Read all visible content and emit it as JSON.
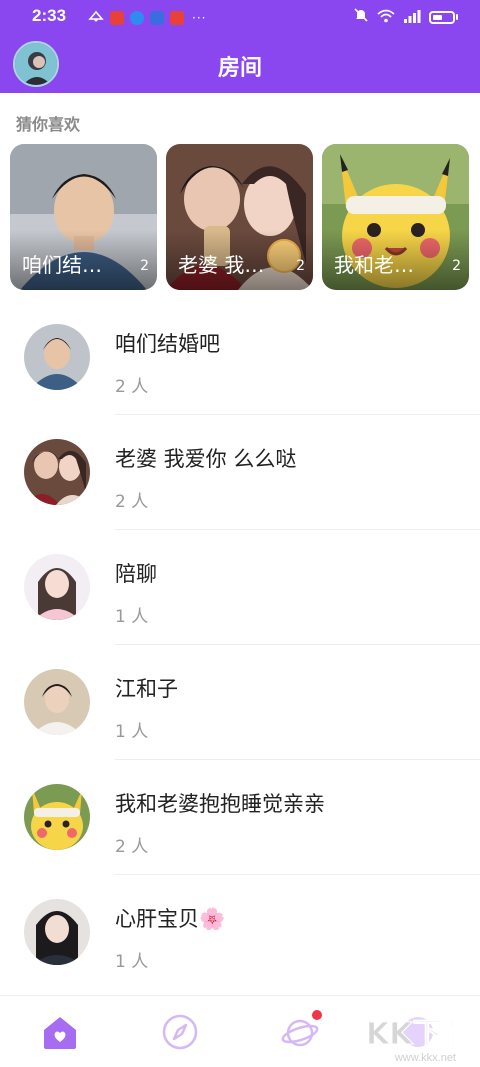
{
  "status_bar": {
    "time": "2:33",
    "more_dots": "···"
  },
  "header": {
    "title": "房间"
  },
  "recommend": {
    "label": "猜你喜欢",
    "cards": [
      {
        "title": "咱们结婚吧",
        "count": "2"
      },
      {
        "title": "老婆 我爱你 么么哒",
        "count": "2"
      },
      {
        "title": "我和老婆抱抱睡觉亲亲",
        "count": "2"
      }
    ]
  },
  "rooms": [
    {
      "name": "咱们结婚吧",
      "count": "2 人"
    },
    {
      "name": "老婆 我爱你 么么哒",
      "count": "2 人"
    },
    {
      "name": "陪聊",
      "count": "1 人"
    },
    {
      "name": "江和子",
      "count": "1 人"
    },
    {
      "name": "我和老婆抱抱睡觉亲亲",
      "count": "2 人"
    },
    {
      "name": "心肝宝贝🌸",
      "count": "1 人"
    }
  ],
  "bottom_nav": {
    "items": [
      "home-icon",
      "compass-icon",
      "planet-icon",
      "profile-icon"
    ]
  },
  "watermark": {
    "logo": "KK下载",
    "url": "www.kkx.net"
  },
  "colors": {
    "brand": "#8a47f0",
    "nav_accent": "#a66cf2",
    "badge": "#f0364a"
  }
}
